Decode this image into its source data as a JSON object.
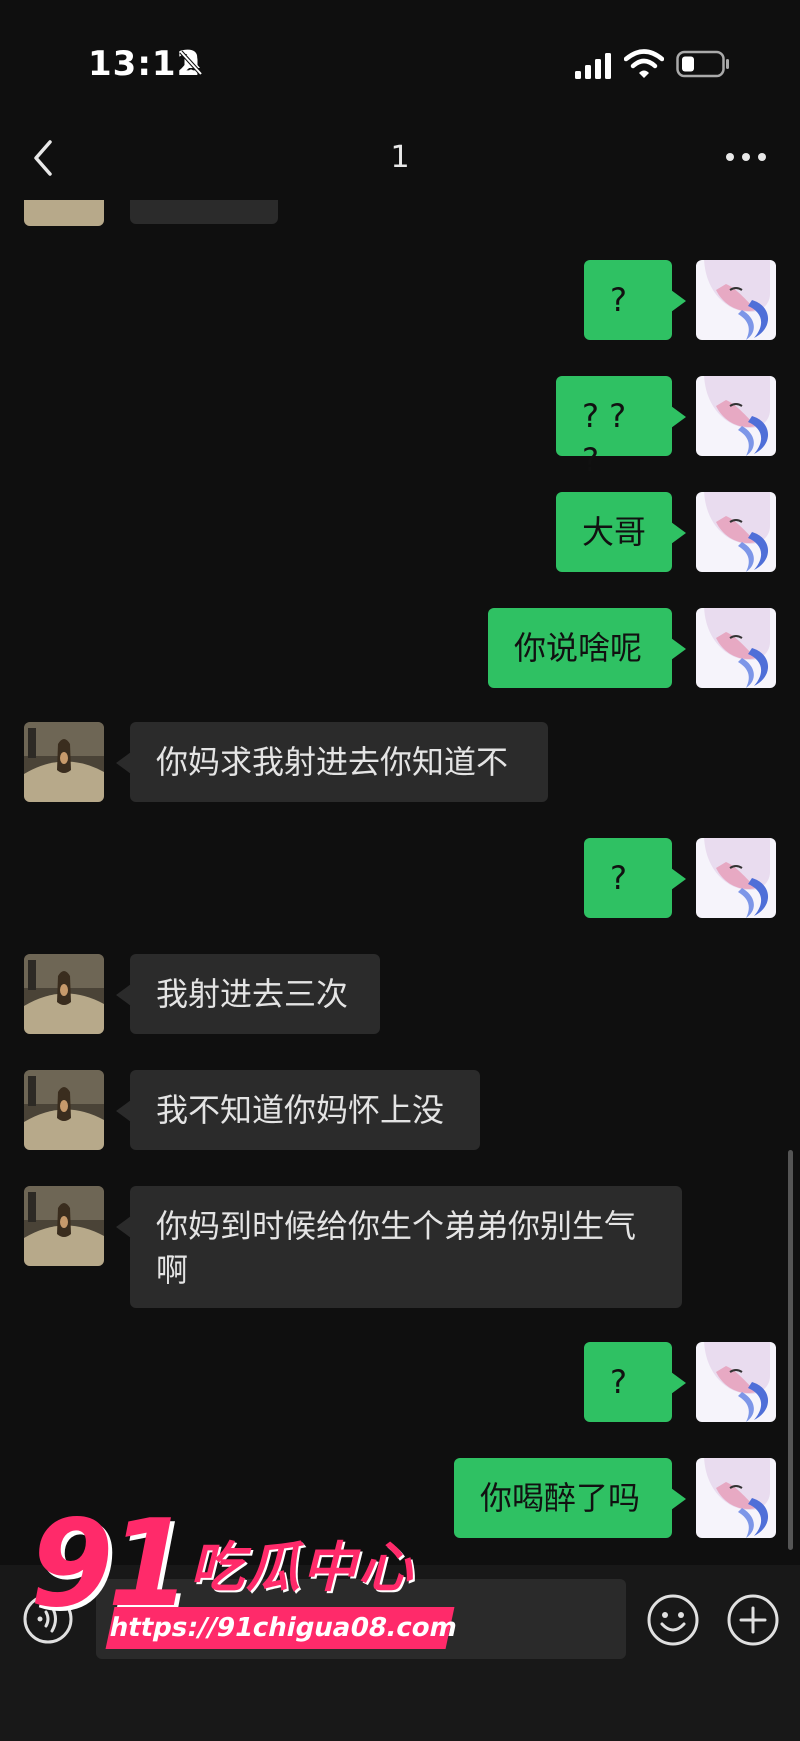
{
  "status_bar": {
    "time": "13:12",
    "icons": [
      "bell-muted-icon",
      "signal-icon",
      "wifi-icon",
      "battery-icon"
    ]
  },
  "header": {
    "title": "1",
    "icons": [
      "back-chevron-icon",
      "more-dots-icon"
    ]
  },
  "colors": {
    "my_bubble": "#2fc163",
    "their_bubble": "#2b2b2b",
    "background": "#0f0f0f",
    "watermark": "#ff2a6a"
  },
  "messages": [
    {
      "sender": "them",
      "text": ""
    },
    {
      "sender": "me",
      "text": "?"
    },
    {
      "sender": "me",
      "text": "? ? ?"
    },
    {
      "sender": "me",
      "text": "大哥"
    },
    {
      "sender": "me",
      "text": "你说啥呢"
    },
    {
      "sender": "them",
      "text": "你妈求我射进去你知道不"
    },
    {
      "sender": "me",
      "text": "?"
    },
    {
      "sender": "them",
      "text": "我射进去三次"
    },
    {
      "sender": "them",
      "text": "我不知道你妈怀上没"
    },
    {
      "sender": "them",
      "text": "你妈到时候给你生个弟弟你别生气啊"
    },
    {
      "sender": "me",
      "text": "?"
    },
    {
      "sender": "me",
      "text": "你喝醉了吗"
    }
  ],
  "input_bar": {
    "placeholder": "",
    "icons": [
      "voice-icon",
      "emoji-icon",
      "plus-icon"
    ]
  },
  "watermark": {
    "number": "91",
    "name": "吃瓜中心",
    "url": "https://91chigua08.com"
  }
}
